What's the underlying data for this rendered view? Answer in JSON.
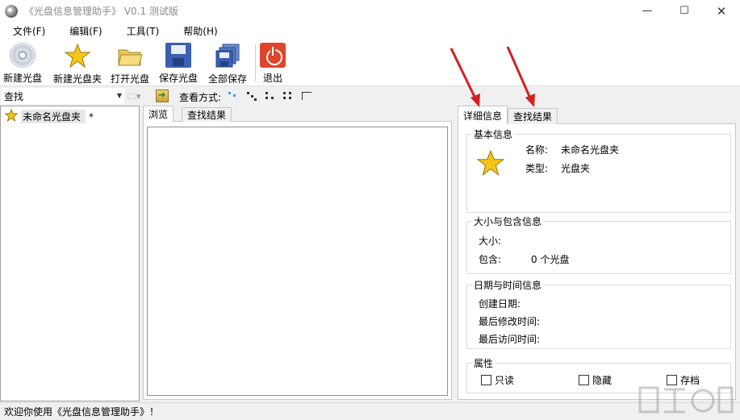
{
  "window": {
    "title": "《光盘信息管理助手》 V0.1 测试版",
    "min_glyph": "—",
    "max_glyph": "☐",
    "close_glyph": "✕"
  },
  "menu": [
    "文件(F)",
    "编辑(F)",
    "工具(T)",
    "帮助(H)"
  ],
  "toolbar": {
    "new_disc": "新建光盘",
    "new_folder": "新建光盘夹",
    "open_disc": "打开光盘",
    "save_disc": "保存光盘",
    "save_all": "全部保存",
    "exit": "退出"
  },
  "search": {
    "value": "查找",
    "view_label": "查看方式:"
  },
  "tree": {
    "item_label": "未命名光盘夹",
    "modified_mark": "*"
  },
  "middle_tabs": [
    "浏览",
    "查找结果"
  ],
  "right_tabs": [
    "详细信息",
    "查找结果"
  ],
  "details": {
    "basic": {
      "title": "基本信息",
      "name_label": "名称:",
      "name_value": "未命名光盘夹",
      "type_label": "类型:",
      "type_value": "光盘夹"
    },
    "size": {
      "title": "大小与包含信息",
      "size_label": "大小:",
      "contains_label": "包含:",
      "contains_value": "0 个光盘"
    },
    "dates": {
      "title": "日期与时间信息",
      "created": "创建日期:",
      "modified": "最后修改时间:",
      "accessed": "最后访问时间:"
    },
    "attributes": {
      "title": "属性",
      "readonly": "只读",
      "hidden": "隐藏",
      "archive": "存档"
    }
  },
  "status": "欢迎你使用《光盘信息管理助手》！",
  "colors": {
    "accent_arrow": "#d42020",
    "exit_red": "#e0442a",
    "save_blue": "#3b5fb3",
    "star_yellow": "#f6c616"
  }
}
